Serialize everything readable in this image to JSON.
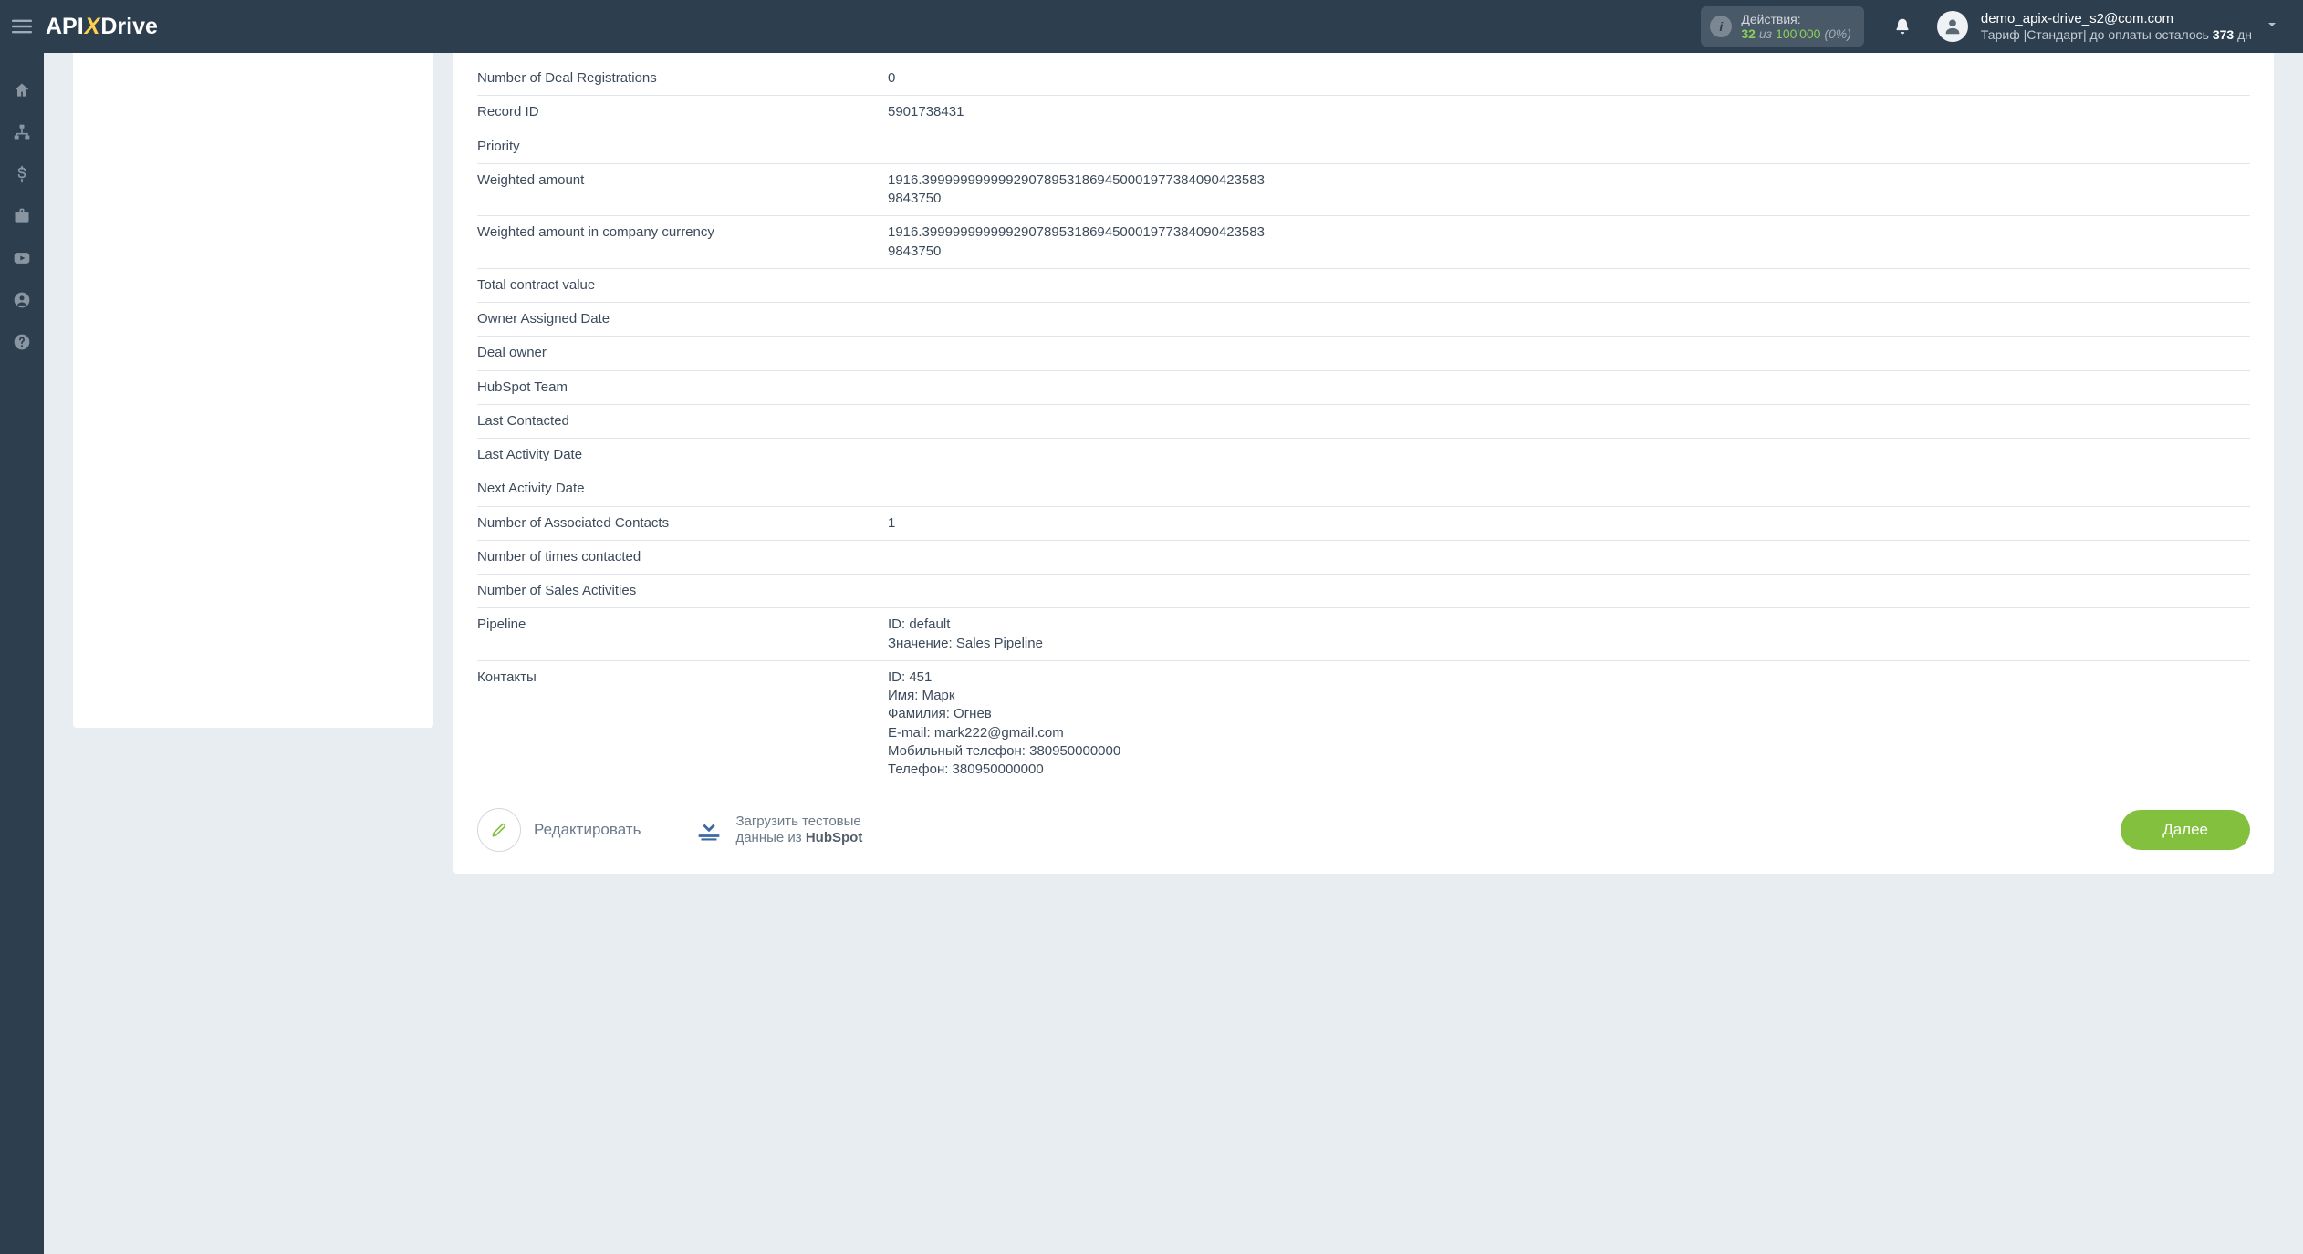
{
  "logo": {
    "part1": "API",
    "part2": "X",
    "part3": "Drive"
  },
  "header": {
    "actions": {
      "label": "Действия:",
      "current": "32",
      "of": "из",
      "max": "100'000",
      "pct": "(0%)"
    },
    "user": {
      "email": "demo_apix-drive_s2@com.com",
      "tariff_prefix": "Тариф |Стандарт| до оплаты осталось ",
      "tariff_days": "373",
      "tariff_suffix": " дн"
    }
  },
  "fields": [
    {
      "label": "Number of Deal Registrations",
      "value": "0"
    },
    {
      "label": "Record ID",
      "value": "5901738431"
    },
    {
      "label": "Priority",
      "value": ""
    },
    {
      "label": "Weighted amount",
      "value": "1916.399999999999290789531869450001977384090423583\n9843750"
    },
    {
      "label": "Weighted amount in company currency",
      "value": "1916.399999999999290789531869450001977384090423583\n9843750"
    },
    {
      "label": "Total contract value",
      "value": ""
    },
    {
      "label": "Owner Assigned Date",
      "value": ""
    },
    {
      "label": "Deal owner",
      "value": ""
    },
    {
      "label": "HubSpot Team",
      "value": ""
    },
    {
      "label": "Last Contacted",
      "value": ""
    },
    {
      "label": "Last Activity Date",
      "value": ""
    },
    {
      "label": "Next Activity Date",
      "value": ""
    },
    {
      "label": "Number of Associated Contacts",
      "value": "1"
    },
    {
      "label": "Number of times contacted",
      "value": ""
    },
    {
      "label": "Number of Sales Activities",
      "value": ""
    },
    {
      "label": "Pipeline",
      "value": "ID: default\nЗначение: Sales Pipeline"
    },
    {
      "label": "Контакты",
      "value": "ID: 451\nИмя: Марк\nФамилия: Огнев\nE-mail: mark222@gmail.com\nМобильный телефон: 380950000000\nТелефон: 380950000000"
    }
  ],
  "actions": {
    "edit": "Редактировать",
    "load_line1": "Загрузить тестовые",
    "load_line2_pre": "данные из ",
    "load_line2_bold": "HubSpot",
    "next": "Далее"
  }
}
